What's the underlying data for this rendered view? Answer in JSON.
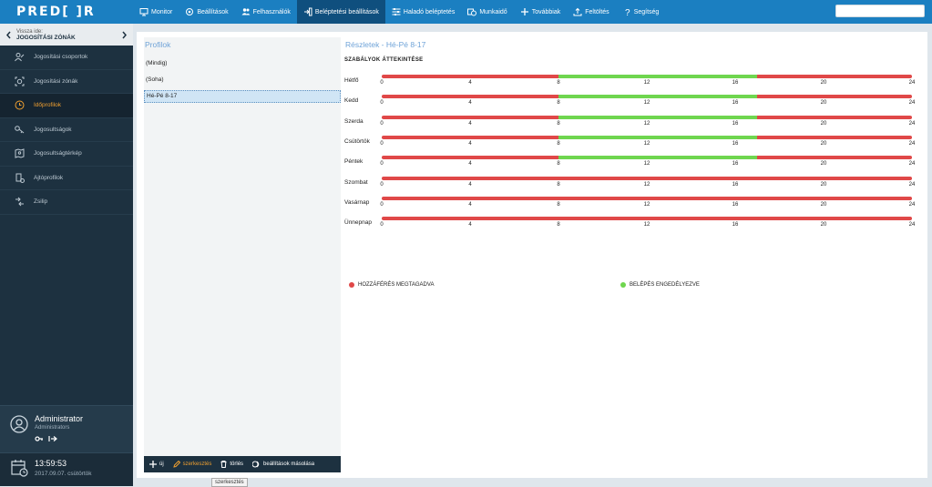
{
  "app": {
    "logo": "PRED[ ]R"
  },
  "nav": {
    "items": [
      {
        "label": "Monitor",
        "icon": "monitor-icon",
        "active": false
      },
      {
        "label": "Beállítások",
        "icon": "settings-icon",
        "active": false
      },
      {
        "label": "Felhasználók",
        "icon": "users-icon",
        "active": false
      },
      {
        "label": "Beléptetési beállítások",
        "icon": "access-icon",
        "active": true
      },
      {
        "label": "Haladó beléptetés",
        "icon": "sliders-icon",
        "active": false
      },
      {
        "label": "Munkaidő",
        "icon": "worktime-icon",
        "active": false
      },
      {
        "label": "Továbbiak",
        "icon": "plus-icon",
        "active": false
      },
      {
        "label": "Feltöltés",
        "icon": "upload-icon",
        "active": false
      },
      {
        "label": "Segítség",
        "icon": "help-icon",
        "active": false
      }
    ]
  },
  "sidebar": {
    "back_label": "Vissza ide:",
    "back_target": "JOGOSÍTÁSI ZÓNÁK",
    "items": [
      {
        "label": "Jogosítási csoportok",
        "icon": "group-icon"
      },
      {
        "label": "Jogosítási zónák",
        "icon": "zone-icon"
      },
      {
        "label": "Időprofilok",
        "icon": "clock-icon"
      },
      {
        "label": "Jogosultságok",
        "icon": "key-icon"
      },
      {
        "label": "Jogosultságtérkép",
        "icon": "map-icon"
      },
      {
        "label": "Ajtóprofilok",
        "icon": "door-icon"
      },
      {
        "label": "Zsilip",
        "icon": "airlock-icon"
      }
    ],
    "active_index": 2,
    "user": {
      "name": "Administrator",
      "role": "Administrators"
    },
    "clock": {
      "time": "13:59:53",
      "date": "2017.09.07. csütörtök"
    }
  },
  "profiles": {
    "title": "Profilok",
    "items": [
      "(Mindig)",
      "(Soha)",
      "Hé-Pé 8-17"
    ],
    "selected_index": 2,
    "toolbar": {
      "new": "új",
      "edit": "szerkesztés",
      "delete": "törlés",
      "copy": "beállítások másolása"
    },
    "tooltip": "szerkesztés"
  },
  "details": {
    "title": "Részletek - Hé-Pé 8-17",
    "section": "SZABÁLYOK ÁTTEKINTÉSE",
    "ticks": [
      "0",
      "4",
      "8",
      "12",
      "16",
      "20",
      "24"
    ],
    "days": [
      {
        "name": "Hétfő",
        "allowed_from": 8,
        "allowed_to": 17
      },
      {
        "name": "Kedd",
        "allowed_from": 8,
        "allowed_to": 17
      },
      {
        "name": "Szerda",
        "allowed_from": 8,
        "allowed_to": 17
      },
      {
        "name": "Csütörtök",
        "allowed_from": 8,
        "allowed_to": 17
      },
      {
        "name": "Péntek",
        "allowed_from": 8,
        "allowed_to": 17
      },
      {
        "name": "Szombat",
        "allowed_from": null,
        "allowed_to": null
      },
      {
        "name": "Vasárnap",
        "allowed_from": null,
        "allowed_to": null
      },
      {
        "name": "Ünnepnap",
        "allowed_from": null,
        "allowed_to": null
      }
    ],
    "legend": {
      "denied": "HOZZÁFÉRÉS MEGTAGADVA",
      "allowed": "BELÉPÉS ENGEDÉLYEZVE"
    },
    "colors": {
      "denied": "#e04848",
      "allowed": "#6fd64f"
    }
  }
}
